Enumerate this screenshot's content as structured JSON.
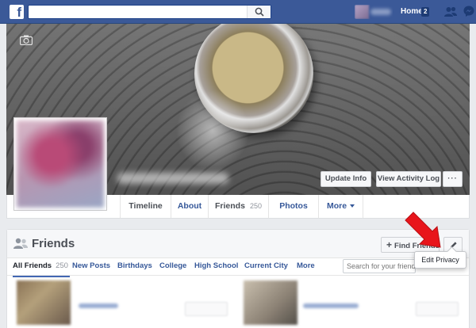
{
  "topbar": {
    "search_placeholder": "",
    "home_label": "Home",
    "home_count": "2"
  },
  "cover": {
    "update_info": "Update Info",
    "view_activity_log": "View Activity Log",
    "more": "···"
  },
  "tabs": {
    "timeline": "Timeline",
    "about": "About",
    "friends": "Friends",
    "friends_count": "250",
    "photos": "Photos",
    "more": "More"
  },
  "friends_section": {
    "title": "Friends",
    "find_friends": "Find Friends",
    "edit_privacy": "Edit Privacy",
    "search_placeholder": "Search for your friends",
    "filters": {
      "all_friends": "All Friends",
      "all_friends_count": "250",
      "new_posts": "New Posts",
      "birthdays": "Birthdays",
      "college": "College",
      "high_school": "High School",
      "current_city": "Current City",
      "more": "More"
    }
  },
  "colors": {
    "brand_blue": "#3b5998",
    "link_blue": "#365899",
    "arrow_red": "#e8151b"
  }
}
